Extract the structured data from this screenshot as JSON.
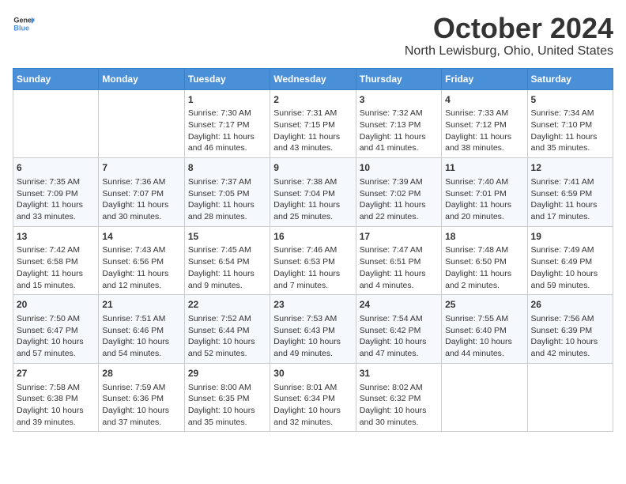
{
  "header": {
    "logo_general": "General",
    "logo_blue": "Blue",
    "title": "October 2024",
    "subtitle": "North Lewisburg, Ohio, United States"
  },
  "days_of_week": [
    "Sunday",
    "Monday",
    "Tuesday",
    "Wednesday",
    "Thursday",
    "Friday",
    "Saturday"
  ],
  "weeks": [
    [
      {
        "day": "",
        "info": ""
      },
      {
        "day": "",
        "info": ""
      },
      {
        "day": "1",
        "info": "Sunrise: 7:30 AM\nSunset: 7:17 PM\nDaylight: 11 hours and 46 minutes."
      },
      {
        "day": "2",
        "info": "Sunrise: 7:31 AM\nSunset: 7:15 PM\nDaylight: 11 hours and 43 minutes."
      },
      {
        "day": "3",
        "info": "Sunrise: 7:32 AM\nSunset: 7:13 PM\nDaylight: 11 hours and 41 minutes."
      },
      {
        "day": "4",
        "info": "Sunrise: 7:33 AM\nSunset: 7:12 PM\nDaylight: 11 hours and 38 minutes."
      },
      {
        "day": "5",
        "info": "Sunrise: 7:34 AM\nSunset: 7:10 PM\nDaylight: 11 hours and 35 minutes."
      }
    ],
    [
      {
        "day": "6",
        "info": "Sunrise: 7:35 AM\nSunset: 7:09 PM\nDaylight: 11 hours and 33 minutes."
      },
      {
        "day": "7",
        "info": "Sunrise: 7:36 AM\nSunset: 7:07 PM\nDaylight: 11 hours and 30 minutes."
      },
      {
        "day": "8",
        "info": "Sunrise: 7:37 AM\nSunset: 7:05 PM\nDaylight: 11 hours and 28 minutes."
      },
      {
        "day": "9",
        "info": "Sunrise: 7:38 AM\nSunset: 7:04 PM\nDaylight: 11 hours and 25 minutes."
      },
      {
        "day": "10",
        "info": "Sunrise: 7:39 AM\nSunset: 7:02 PM\nDaylight: 11 hours and 22 minutes."
      },
      {
        "day": "11",
        "info": "Sunrise: 7:40 AM\nSunset: 7:01 PM\nDaylight: 11 hours and 20 minutes."
      },
      {
        "day": "12",
        "info": "Sunrise: 7:41 AM\nSunset: 6:59 PM\nDaylight: 11 hours and 17 minutes."
      }
    ],
    [
      {
        "day": "13",
        "info": "Sunrise: 7:42 AM\nSunset: 6:58 PM\nDaylight: 11 hours and 15 minutes."
      },
      {
        "day": "14",
        "info": "Sunrise: 7:43 AM\nSunset: 6:56 PM\nDaylight: 11 hours and 12 minutes."
      },
      {
        "day": "15",
        "info": "Sunrise: 7:45 AM\nSunset: 6:54 PM\nDaylight: 11 hours and 9 minutes."
      },
      {
        "day": "16",
        "info": "Sunrise: 7:46 AM\nSunset: 6:53 PM\nDaylight: 11 hours and 7 minutes."
      },
      {
        "day": "17",
        "info": "Sunrise: 7:47 AM\nSunset: 6:51 PM\nDaylight: 11 hours and 4 minutes."
      },
      {
        "day": "18",
        "info": "Sunrise: 7:48 AM\nSunset: 6:50 PM\nDaylight: 11 hours and 2 minutes."
      },
      {
        "day": "19",
        "info": "Sunrise: 7:49 AM\nSunset: 6:49 PM\nDaylight: 10 hours and 59 minutes."
      }
    ],
    [
      {
        "day": "20",
        "info": "Sunrise: 7:50 AM\nSunset: 6:47 PM\nDaylight: 10 hours and 57 minutes."
      },
      {
        "day": "21",
        "info": "Sunrise: 7:51 AM\nSunset: 6:46 PM\nDaylight: 10 hours and 54 minutes."
      },
      {
        "day": "22",
        "info": "Sunrise: 7:52 AM\nSunset: 6:44 PM\nDaylight: 10 hours and 52 minutes."
      },
      {
        "day": "23",
        "info": "Sunrise: 7:53 AM\nSunset: 6:43 PM\nDaylight: 10 hours and 49 minutes."
      },
      {
        "day": "24",
        "info": "Sunrise: 7:54 AM\nSunset: 6:42 PM\nDaylight: 10 hours and 47 minutes."
      },
      {
        "day": "25",
        "info": "Sunrise: 7:55 AM\nSunset: 6:40 PM\nDaylight: 10 hours and 44 minutes."
      },
      {
        "day": "26",
        "info": "Sunrise: 7:56 AM\nSunset: 6:39 PM\nDaylight: 10 hours and 42 minutes."
      }
    ],
    [
      {
        "day": "27",
        "info": "Sunrise: 7:58 AM\nSunset: 6:38 PM\nDaylight: 10 hours and 39 minutes."
      },
      {
        "day": "28",
        "info": "Sunrise: 7:59 AM\nSunset: 6:36 PM\nDaylight: 10 hours and 37 minutes."
      },
      {
        "day": "29",
        "info": "Sunrise: 8:00 AM\nSunset: 6:35 PM\nDaylight: 10 hours and 35 minutes."
      },
      {
        "day": "30",
        "info": "Sunrise: 8:01 AM\nSunset: 6:34 PM\nDaylight: 10 hours and 32 minutes."
      },
      {
        "day": "31",
        "info": "Sunrise: 8:02 AM\nSunset: 6:32 PM\nDaylight: 10 hours and 30 minutes."
      },
      {
        "day": "",
        "info": ""
      },
      {
        "day": "",
        "info": ""
      }
    ]
  ]
}
